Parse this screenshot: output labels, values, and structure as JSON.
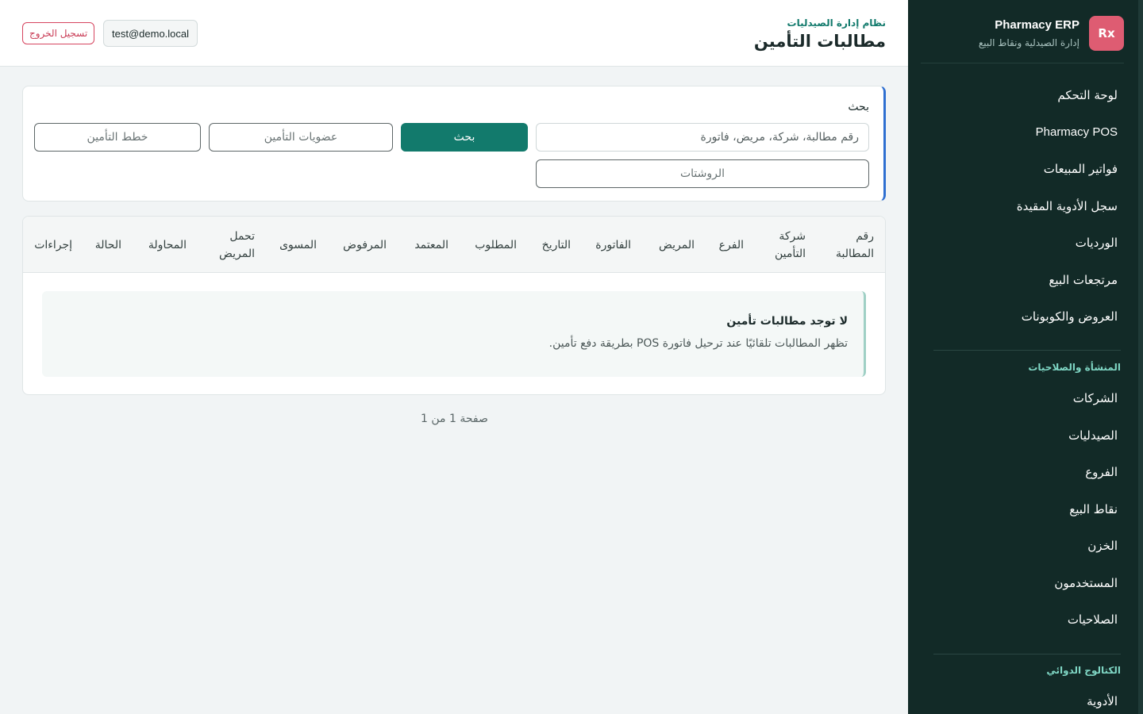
{
  "brand": {
    "logo_text": "Rx",
    "title": "Pharmacy ERP",
    "subtitle": "إدارة الصيدلية ونقاط البيع"
  },
  "sidebar": {
    "main_items": [
      {
        "label": "لوحة التحكم"
      },
      {
        "label": "Pharmacy POS"
      },
      {
        "label": "فواتير المبيعات"
      },
      {
        "label": "سجل الأدوية المقيدة"
      },
      {
        "label": "الورديات"
      },
      {
        "label": "مرتجعات البيع"
      },
      {
        "label": "العروض والكوبونات"
      }
    ],
    "sections": [
      {
        "title": "المنشأة والصلاحيات",
        "items": [
          {
            "label": "الشركات"
          },
          {
            "label": "الصيدليات"
          },
          {
            "label": "الفروع"
          },
          {
            "label": "نقاط البيع"
          },
          {
            "label": "الخزن"
          },
          {
            "label": "المستخدمون"
          },
          {
            "label": "الصلاحيات"
          }
        ]
      },
      {
        "title": "الكتالوج الدوائي",
        "items": [
          {
            "label": "الأدوية"
          }
        ]
      }
    ]
  },
  "header": {
    "kicker": "نظام إدارة الصيدليات",
    "title": "مطالبات التأمين",
    "user_email": "test@demo.local",
    "logout_label": "تسجيل الخروج"
  },
  "search": {
    "label": "بحث",
    "placeholder": "رقم مطالبة، شركة، مريض، فاتورة",
    "value": "",
    "submit_label": "بحث",
    "memberships_label": "عضويات التأمين",
    "plans_label": "خطط التأمين",
    "prescriptions_label": "الروشتات"
  },
  "table": {
    "columns": [
      "رقم المطالبة",
      "شركة التأمين",
      "الفرع",
      "المريض",
      "الفاتورة",
      "التاريخ",
      "المطلوب",
      "المعتمد",
      "المرفوض",
      "المسوى",
      "تحمل المريض",
      "المحاولة",
      "الحالة",
      "إجراءات"
    ],
    "empty_title": "لا توجد مطالبات تأمين",
    "empty_description": "تظهر المطالبات تلقائيًا عند ترحيل فاتورة POS بطريقة دفع تأمين."
  },
  "pagination": {
    "text": "صفحة 1 من 1"
  },
  "colors": {
    "sidebar_bg": "#122a27",
    "accent": "#127a6c",
    "logo_bg": "#de5c72",
    "danger": "#c93b55",
    "section_title": "#7fd6c4"
  }
}
